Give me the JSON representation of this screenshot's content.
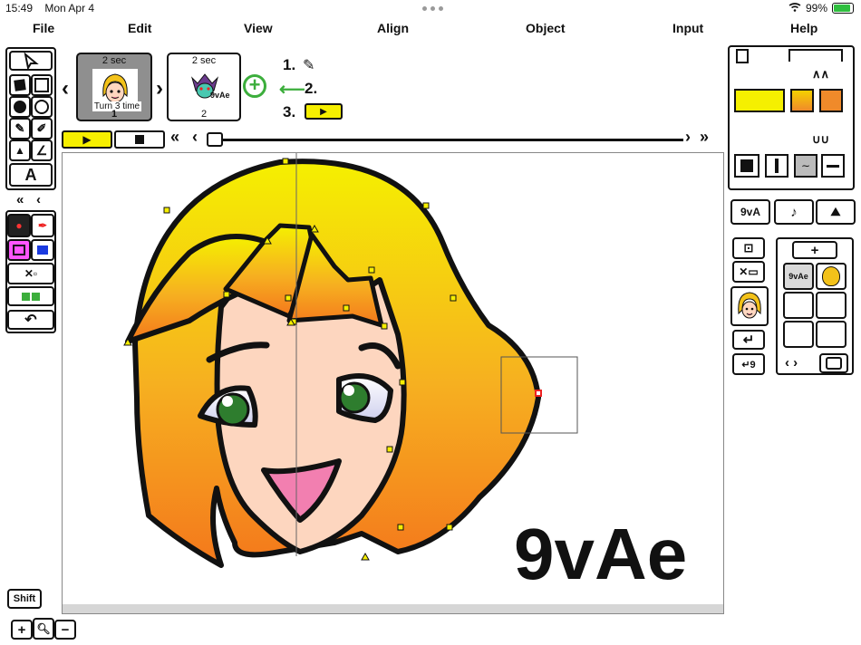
{
  "status_bar": {
    "time": "15:49",
    "date": "Mon Apr 4",
    "battery": "99%",
    "battery_level": 0.99
  },
  "menu": [
    "File",
    "Edit",
    "View",
    "Align",
    "Object",
    "Input",
    "Help"
  ],
  "frames": [
    {
      "duration": "2 sec",
      "number": "1",
      "caption": "Turn 3 time",
      "selected": true
    },
    {
      "duration": "2 sec",
      "number": "2",
      "caption": "9vAe",
      "selected": false
    }
  ],
  "steps": [
    "1.",
    "2.",
    "3."
  ],
  "canvas_logo": "9vAe",
  "left_toolbar": {
    "shift_label": "Shift"
  },
  "right_panel": {
    "logo_button": "9vA"
  },
  "colors": {
    "fill_yellow": "#f5f000",
    "fill_orange": "#f08a2a",
    "gradient_start": "#f6b020",
    "accent_green": "#3cae3c",
    "play_yellow": "#f6ef00",
    "pink": "#ff55ff",
    "blue": "#1b3be0"
  }
}
